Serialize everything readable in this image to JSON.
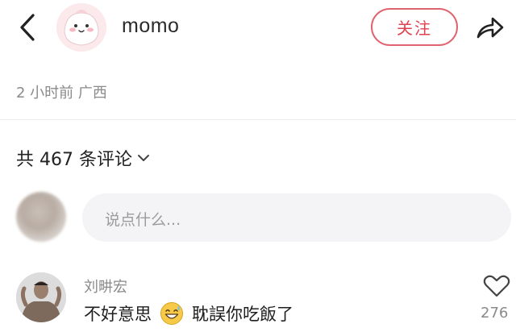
{
  "header": {
    "username": "momo",
    "follow_label": "关注"
  },
  "post": {
    "meta": "2 小时前 广西"
  },
  "comments": {
    "count_label": "共 467 条评论",
    "input_placeholder": "说点什么...",
    "items": [
      {
        "author": "刘畊宏",
        "text_before": "不好意思",
        "text_after": "耽誤你吃飯了",
        "likes": "276"
      }
    ]
  },
  "colors": {
    "accent": "#e0414f",
    "muted": "#8a8a8a",
    "input_bg": "#f4f4f6"
  },
  "icons": [
    "back-arrow-icon",
    "share-icon",
    "chevron-down-icon",
    "grinning-sweat-emoji-icon",
    "heart-outline-icon"
  ]
}
